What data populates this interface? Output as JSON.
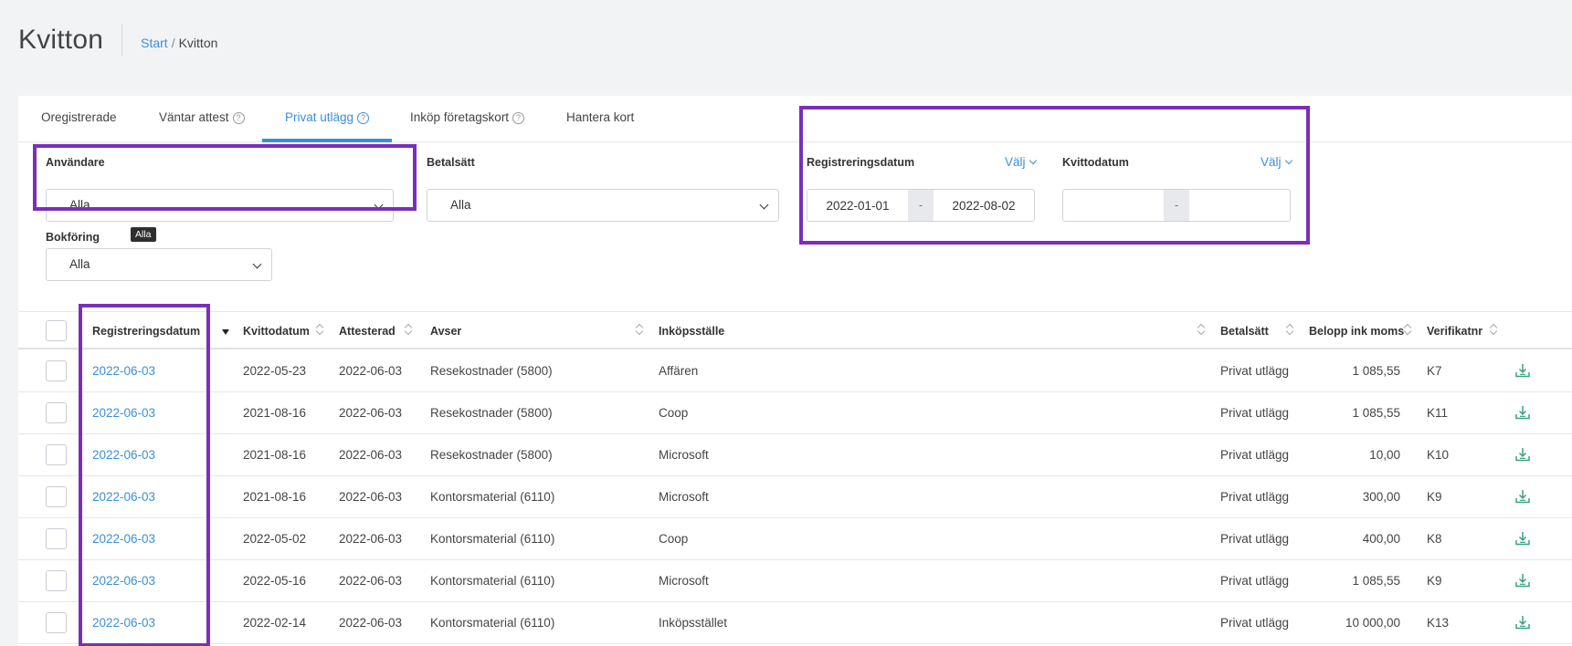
{
  "header": {
    "title": "Kvitton",
    "breadcrumb": {
      "start": "Start",
      "separator": "/",
      "current": "Kvitton"
    }
  },
  "tabs": [
    {
      "label": "Oregistrerade",
      "help": false,
      "active": false
    },
    {
      "label": "Väntar attest",
      "help": true,
      "active": false
    },
    {
      "label": "Privat utlägg",
      "help": true,
      "active": true
    },
    {
      "label": "Inköp företagskort",
      "help": true,
      "active": false
    },
    {
      "label": "Hantera kort",
      "help": false,
      "active": false
    }
  ],
  "filters": {
    "user": {
      "label": "Användare",
      "value": "Alla"
    },
    "payment": {
      "label": "Betalsätt",
      "value": "Alla"
    },
    "registration_date": {
      "label": "Registreringsdatum",
      "choose": "Välj",
      "from": "2022-01-01",
      "to": "2022-08-02",
      "dash": "-"
    },
    "receipt_date": {
      "label": "Kvittodatum",
      "choose": "Välj",
      "from": "",
      "to": "",
      "dash": "-"
    },
    "booking": {
      "label": "Bokföring",
      "value": "Alla"
    },
    "tooltip": "Alla"
  },
  "table": {
    "columns": {
      "registration_date": "Registreringsdatum",
      "receipt_date": "Kvittodatum",
      "approved": "Attesterad",
      "regarding": "Avser",
      "store": "Inköpsställe",
      "payment": "Betalsätt",
      "amount": "Belopp ink moms",
      "voucher": "Verifikatnr"
    },
    "rows": [
      {
        "registration_date": "2022-06-03",
        "receipt_date": "2022-05-23",
        "approved": "2022-06-03",
        "regarding": "Resekostnader (5800)",
        "store": "Affären",
        "payment": "Privat utlägg",
        "amount": "1 085,55",
        "voucher": "K7"
      },
      {
        "registration_date": "2022-06-03",
        "receipt_date": "2021-08-16",
        "approved": "2022-06-03",
        "regarding": "Resekostnader (5800)",
        "store": "Coop",
        "payment": "Privat utlägg",
        "amount": "1 085,55",
        "voucher": "K11"
      },
      {
        "registration_date": "2022-06-03",
        "receipt_date": "2021-08-16",
        "approved": "2022-06-03",
        "regarding": "Resekostnader (5800)",
        "store": "Microsoft",
        "payment": "Privat utlägg",
        "amount": "10,00",
        "voucher": "K10"
      },
      {
        "registration_date": "2022-06-03",
        "receipt_date": "2021-08-16",
        "approved": "2022-06-03",
        "regarding": "Kontorsmaterial (6110)",
        "store": "Microsoft",
        "payment": "Privat utlägg",
        "amount": "300,00",
        "voucher": "K9"
      },
      {
        "registration_date": "2022-06-03",
        "receipt_date": "2022-05-02",
        "approved": "2022-06-03",
        "regarding": "Kontorsmaterial (6110)",
        "store": "Coop",
        "payment": "Privat utlägg",
        "amount": "400,00",
        "voucher": "K8"
      },
      {
        "registration_date": "2022-06-03",
        "receipt_date": "2022-05-16",
        "approved": "2022-06-03",
        "regarding": "Kontorsmaterial (6110)",
        "store": "Microsoft",
        "payment": "Privat utlägg",
        "amount": "1 085,55",
        "voucher": "K9"
      },
      {
        "registration_date": "2022-06-03",
        "receipt_date": "2022-02-14",
        "approved": "2022-06-03",
        "regarding": "Kontorsmaterial (6110)",
        "store": "Inköpsstället",
        "payment": "Privat utlägg",
        "amount": "10 000,00",
        "voucher": "K13"
      }
    ]
  },
  "colors": {
    "accent": "#3b8fd9",
    "highlight": "#7a2fb8",
    "download_icon": "#3aa37a"
  }
}
